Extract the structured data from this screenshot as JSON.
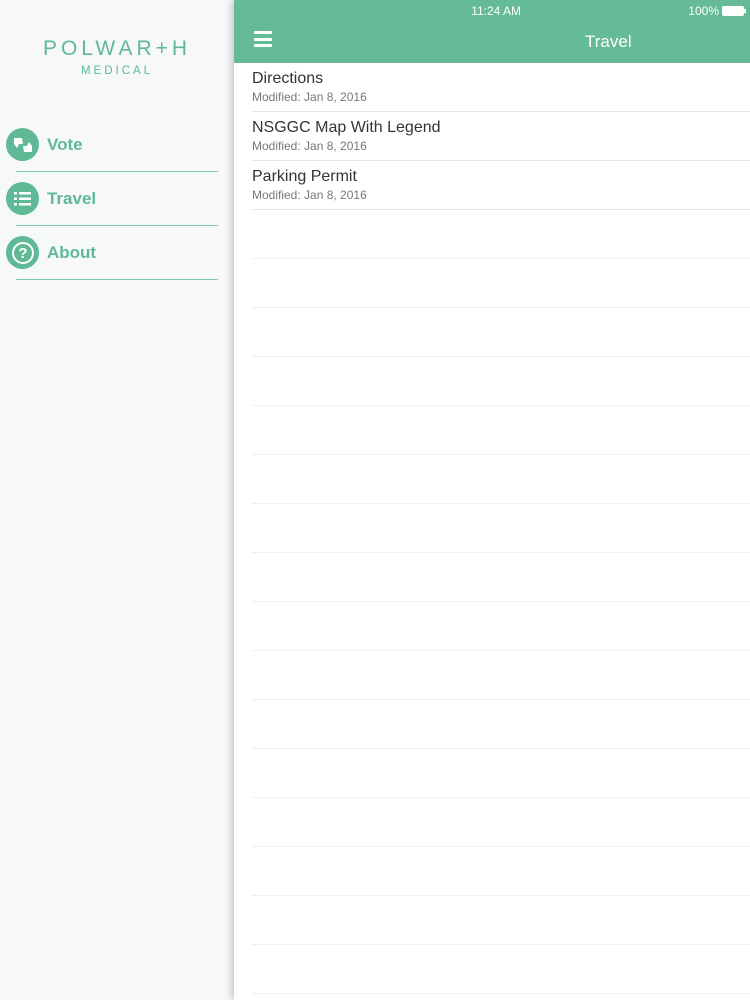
{
  "status_bar": {
    "time": "11:24 AM",
    "battery": "100%"
  },
  "logo": {
    "main": "POLWAR+H",
    "sub": "MEDICAL"
  },
  "sidebar": {
    "items": [
      {
        "label": "Vote",
        "icon": "vote-icon"
      },
      {
        "label": "Travel",
        "icon": "list-icon"
      },
      {
        "label": "About",
        "icon": "question-icon"
      }
    ]
  },
  "header": {
    "title": "Travel"
  },
  "documents": [
    {
      "title": "Directions",
      "modified": "Modified: Jan 8, 2016"
    },
    {
      "title": "NSGGC Map With Legend",
      "modified": "Modified: Jan 8, 2016"
    },
    {
      "title": "Parking Permit",
      "modified": "Modified: Jan 8, 2016"
    }
  ],
  "colors": {
    "accent": "#5fb996",
    "header": "#65bb98"
  }
}
